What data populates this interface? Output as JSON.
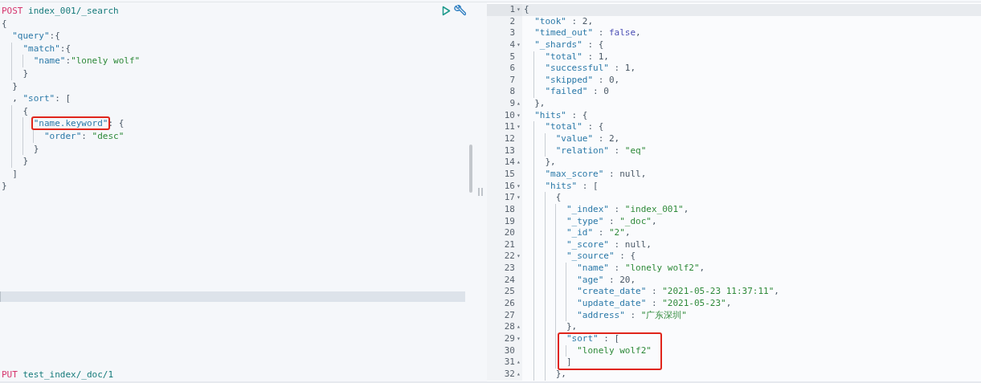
{
  "request_editor": {
    "requests": [
      {
        "lines": [
          {
            "tokens": [
              {
                "kind": "method",
                "text": "POST"
              },
              {
                "kind": "url",
                "text": " index_001/_search"
              }
            ]
          },
          {
            "tokens": [
              {
                "kind": "punct",
                "text": "{"
              }
            ]
          },
          {
            "tokens": [
              {
                "kind": "key",
                "text": "  \"query\""
              },
              {
                "kind": "punct",
                "text": ":{"
              }
            ]
          },
          {
            "tokens": [
              {
                "kind": "key",
                "text": "    \"match\""
              },
              {
                "kind": "punct",
                "text": ":{"
              }
            ]
          },
          {
            "tokens": [
              {
                "kind": "key",
                "text": "      \"name\""
              },
              {
                "kind": "punct",
                "text": ":"
              },
              {
                "kind": "string",
                "text": "\"lonely wolf\""
              }
            ]
          },
          {
            "tokens": [
              {
                "kind": "punct",
                "text": "    }"
              }
            ]
          },
          {
            "tokens": [
              {
                "kind": "punct",
                "text": "  }"
              }
            ]
          },
          {
            "tokens": [
              {
                "kind": "punct",
                "text": "  , "
              },
              {
                "kind": "key",
                "text": "\"sort\""
              },
              {
                "kind": "punct",
                "text": ": ["
              }
            ]
          },
          {
            "tokens": [
              {
                "kind": "punct",
                "text": "    {"
              }
            ]
          },
          {
            "tokens": [
              {
                "kind": "key",
                "text": "      \"name.keyword\"",
                "highlighted": true
              },
              {
                "kind": "punct",
                "text": ": {"
              }
            ]
          },
          {
            "tokens": [
              {
                "kind": "key",
                "text": "        \"order\""
              },
              {
                "kind": "punct",
                "text": ": "
              },
              {
                "kind": "string",
                "text": "\"desc\""
              }
            ]
          },
          {
            "tokens": [
              {
                "kind": "punct",
                "text": "      }"
              }
            ]
          },
          {
            "tokens": [
              {
                "kind": "punct",
                "text": "    }"
              }
            ]
          },
          {
            "tokens": [
              {
                "kind": "punct",
                "text": "  ]"
              }
            ]
          },
          {
            "tokens": [
              {
                "kind": "punct",
                "text": "}"
              }
            ]
          }
        ]
      },
      {
        "lines": [
          {
            "tokens": [
              {
                "kind": "method",
                "text": "PUT"
              },
              {
                "kind": "url",
                "text": " test_index/_doc/1"
              }
            ]
          }
        ]
      }
    ]
  },
  "response_viewer": {
    "lines": [
      {
        "number": "1",
        "fold": "▾",
        "active": true,
        "tokens": [
          {
            "kind": "punct",
            "text": "{"
          }
        ]
      },
      {
        "number": "2",
        "tokens": [
          {
            "kind": "key",
            "text": "  \"took\""
          },
          {
            "kind": "punct",
            "text": " : 2,"
          }
        ]
      },
      {
        "number": "3",
        "tokens": [
          {
            "kind": "key",
            "text": "  \"timed_out\""
          },
          {
            "kind": "punct",
            "text": " : "
          },
          {
            "kind": "literal",
            "text": "false"
          },
          {
            "kind": "punct",
            "text": ","
          }
        ]
      },
      {
        "number": "4",
        "fold": "▾",
        "tokens": [
          {
            "kind": "key",
            "text": "  \"_shards\""
          },
          {
            "kind": "punct",
            "text": " : {"
          }
        ]
      },
      {
        "number": "5",
        "tokens": [
          {
            "kind": "key",
            "text": "    \"total\""
          },
          {
            "kind": "punct",
            "text": " : 1,"
          }
        ]
      },
      {
        "number": "6",
        "tokens": [
          {
            "kind": "key",
            "text": "    \"successful\""
          },
          {
            "kind": "punct",
            "text": " : 1,"
          }
        ]
      },
      {
        "number": "7",
        "tokens": [
          {
            "kind": "key",
            "text": "    \"skipped\""
          },
          {
            "kind": "punct",
            "text": " : 0,"
          }
        ]
      },
      {
        "number": "8",
        "tokens": [
          {
            "kind": "key",
            "text": "    \"failed\""
          },
          {
            "kind": "punct",
            "text": " : 0"
          }
        ]
      },
      {
        "number": "9",
        "fold": "▴",
        "tokens": [
          {
            "kind": "punct",
            "text": "  },"
          }
        ]
      },
      {
        "number": "10",
        "fold": "▾",
        "tokens": [
          {
            "kind": "key",
            "text": "  \"hits\""
          },
          {
            "kind": "punct",
            "text": " : {"
          }
        ]
      },
      {
        "number": "11",
        "fold": "▾",
        "tokens": [
          {
            "kind": "key",
            "text": "    \"total\""
          },
          {
            "kind": "punct",
            "text": " : {"
          }
        ]
      },
      {
        "number": "12",
        "tokens": [
          {
            "kind": "key",
            "text": "      \"value\""
          },
          {
            "kind": "punct",
            "text": " : 2,"
          }
        ]
      },
      {
        "number": "13",
        "tokens": [
          {
            "kind": "key",
            "text": "      \"relation\""
          },
          {
            "kind": "punct",
            "text": " : "
          },
          {
            "kind": "string",
            "text": "\"eq\""
          }
        ]
      },
      {
        "number": "14",
        "fold": "▴",
        "tokens": [
          {
            "kind": "punct",
            "text": "    },"
          }
        ]
      },
      {
        "number": "15",
        "tokens": [
          {
            "kind": "key",
            "text": "    \"max_score\""
          },
          {
            "kind": "punct",
            "text": " : null,"
          }
        ]
      },
      {
        "number": "16",
        "fold": "▾",
        "tokens": [
          {
            "kind": "key",
            "text": "    \"hits\""
          },
          {
            "kind": "punct",
            "text": " : ["
          }
        ]
      },
      {
        "number": "17",
        "fold": "▾",
        "tokens": [
          {
            "kind": "punct",
            "text": "      {"
          }
        ]
      },
      {
        "number": "18",
        "tokens": [
          {
            "kind": "key",
            "text": "        \"_index\""
          },
          {
            "kind": "punct",
            "text": " : "
          },
          {
            "kind": "string",
            "text": "\"index_001\""
          },
          {
            "kind": "punct",
            "text": ","
          }
        ]
      },
      {
        "number": "19",
        "tokens": [
          {
            "kind": "key",
            "text": "        \"_type\""
          },
          {
            "kind": "punct",
            "text": " : "
          },
          {
            "kind": "string",
            "text": "\"_doc\""
          },
          {
            "kind": "punct",
            "text": ","
          }
        ]
      },
      {
        "number": "20",
        "tokens": [
          {
            "kind": "key",
            "text": "        \"_id\""
          },
          {
            "kind": "punct",
            "text": " : "
          },
          {
            "kind": "string",
            "text": "\"2\""
          },
          {
            "kind": "punct",
            "text": ","
          }
        ]
      },
      {
        "number": "21",
        "tokens": [
          {
            "kind": "key",
            "text": "        \"_score\""
          },
          {
            "kind": "punct",
            "text": " : null,"
          }
        ]
      },
      {
        "number": "22",
        "fold": "▾",
        "tokens": [
          {
            "kind": "key",
            "text": "        \"_source\""
          },
          {
            "kind": "punct",
            "text": " : {"
          }
        ]
      },
      {
        "number": "23",
        "tokens": [
          {
            "kind": "key",
            "text": "          \"name\""
          },
          {
            "kind": "punct",
            "text": " : "
          },
          {
            "kind": "string",
            "text": "\"lonely wolf2\""
          },
          {
            "kind": "punct",
            "text": ","
          }
        ]
      },
      {
        "number": "24",
        "tokens": [
          {
            "kind": "key",
            "text": "          \"age\""
          },
          {
            "kind": "punct",
            "text": " : 20,"
          }
        ]
      },
      {
        "number": "25",
        "tokens": [
          {
            "kind": "key",
            "text": "          \"create_date\""
          },
          {
            "kind": "punct",
            "text": " : "
          },
          {
            "kind": "string",
            "text": "\"2021-05-23 11:37:11\""
          },
          {
            "kind": "punct",
            "text": ","
          }
        ]
      },
      {
        "number": "26",
        "tokens": [
          {
            "kind": "key",
            "text": "          \"update_date\""
          },
          {
            "kind": "punct",
            "text": " : "
          },
          {
            "kind": "string",
            "text": "\"2021-05-23\""
          },
          {
            "kind": "punct",
            "text": ","
          }
        ]
      },
      {
        "number": "27",
        "tokens": [
          {
            "kind": "key",
            "text": "          \"address\""
          },
          {
            "kind": "punct",
            "text": " : "
          },
          {
            "kind": "string",
            "text": "\"广东深圳\""
          }
        ]
      },
      {
        "number": "28",
        "fold": "▴",
        "tokens": [
          {
            "kind": "punct",
            "text": "        },"
          }
        ]
      },
      {
        "number": "29",
        "fold": "▾",
        "highlighted": true,
        "tokens": [
          {
            "kind": "key",
            "text": "        \"sort\""
          },
          {
            "kind": "punct",
            "text": " : ["
          }
        ]
      },
      {
        "number": "30",
        "highlighted": true,
        "tokens": [
          {
            "kind": "string",
            "text": "          \"lonely wolf2\""
          }
        ]
      },
      {
        "number": "31",
        "fold": "▴",
        "highlighted": true,
        "tokens": [
          {
            "kind": "punct",
            "text": "        ]"
          }
        ]
      },
      {
        "number": "32",
        "fold": "▴",
        "tokens": [
          {
            "kind": "punct",
            "text": "      },"
          }
        ]
      }
    ]
  }
}
